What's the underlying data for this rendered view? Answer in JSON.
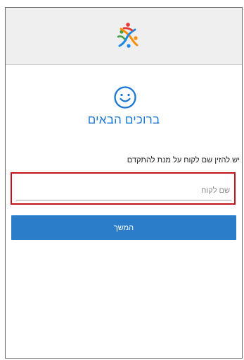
{
  "header": {
    "logo_icon": "colorful-x-figure-logo-icon",
    "background_color": "#efefef"
  },
  "welcome": {
    "icon": "smiley-icon",
    "title": "ברוכים הבאים",
    "accent_color": "#1976d2"
  },
  "form": {
    "instruction": "יש להזין שם לקוח על מנת להתקדם",
    "customer_name_placeholder": "שם לקוח",
    "customer_name_value": "",
    "continue_button_label": "המשך",
    "button_color": "#2b7cc9",
    "highlight_color": "#c1151b"
  }
}
